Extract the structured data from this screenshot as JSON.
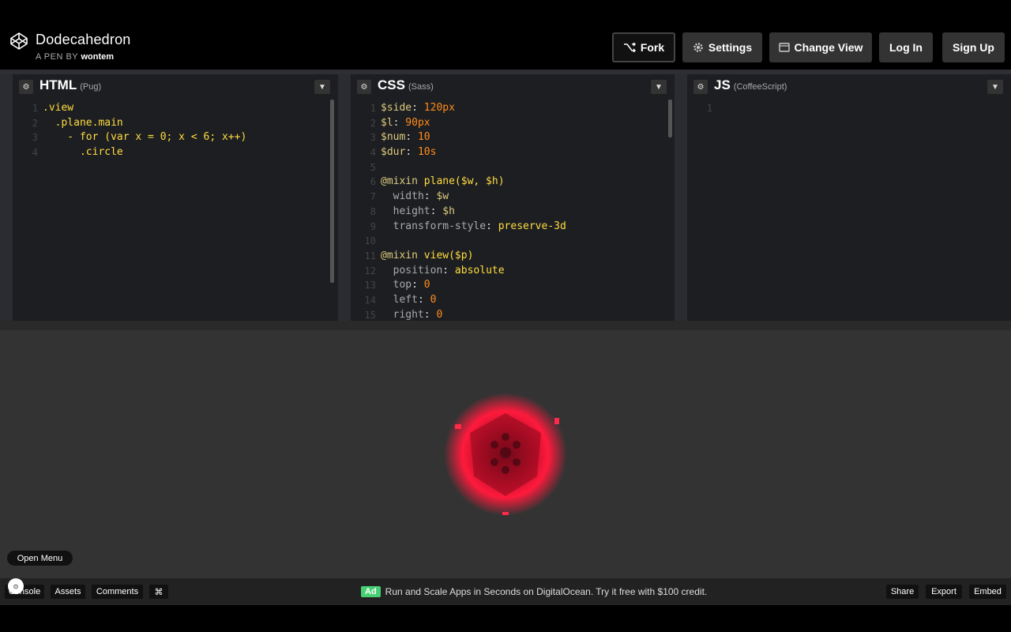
{
  "header": {
    "title": "Dodecahedron",
    "byline_prefix": "A PEN BY",
    "author": "wontem",
    "buttons": {
      "fork": "Fork",
      "settings": "Settings",
      "change_view": "Change View",
      "login": "Log In",
      "signup": "Sign Up"
    }
  },
  "panes": {
    "html": {
      "name": "HTML",
      "sub": "(Pug)",
      "lines": [
        ".view",
        "  .plane.main",
        "    - for (var x = 0; x < 6; x++)",
        "      .circle"
      ]
    },
    "css": {
      "name": "CSS",
      "sub": "(Sass)",
      "lines": [
        "$side: 120px",
        "$l: 90px",
        "$num: 10",
        "$dur: 10s",
        "",
        "@mixin plane($w, $h)",
        "  width: $w",
        "  height: $h",
        "  transform-style: preserve-3d",
        "",
        "@mixin view($p)",
        "  position: absolute",
        "  top: 0",
        "  left: 0",
        "  right: 0"
      ]
    },
    "js": {
      "name": "JS",
      "sub": "(CoffeeScript)",
      "lines": [
        ""
      ]
    }
  },
  "preview": {
    "open_menu": "Open Menu"
  },
  "footer": {
    "console": "Console",
    "assets": "Assets",
    "comments": "Comments",
    "shortcut": "⌘",
    "ad_badge": "Ad",
    "ad_text": "Run and Scale Apps in Seconds on DigitalOcean. Try it free with $100 credit.",
    "share": "Share",
    "export": "Export",
    "embed": "Embed"
  },
  "colors": {
    "accent_green": "#47cf73",
    "orb_red": "#ff1a3c"
  }
}
